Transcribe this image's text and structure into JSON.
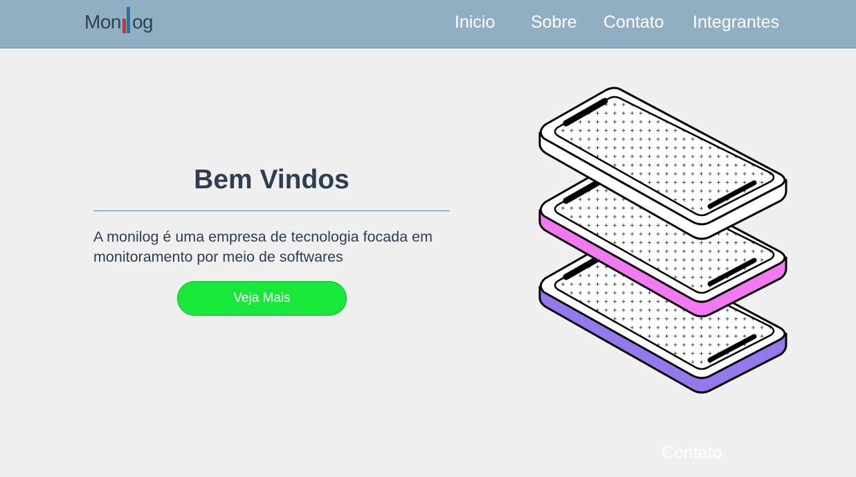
{
  "header": {
    "logo_text_start": "Mon",
    "logo_text_end": "og",
    "nav": [
      {
        "label": "Inicio"
      },
      {
        "label": "Sobre"
      },
      {
        "label": "Contato"
      },
      {
        "label": "Integrantes"
      }
    ]
  },
  "hero": {
    "title": "Bem Vindos",
    "description": "A monilog é uma empresa de tecnologia focada em monitoramento por meio de softwares",
    "cta_label": "Veja Mais"
  },
  "illustration": {
    "icon": "stacked-phones-illustration",
    "layer_colors": [
      "#ffffff",
      "#f279f2",
      "#9678ee"
    ]
  },
  "footer": {
    "contact_label": "Contato"
  },
  "colors": {
    "navbar": "#91afc3",
    "background": "#f0f0f0",
    "accent_button": "#17e839",
    "divider": "#3e86bd",
    "text": "#2d3e50"
  }
}
